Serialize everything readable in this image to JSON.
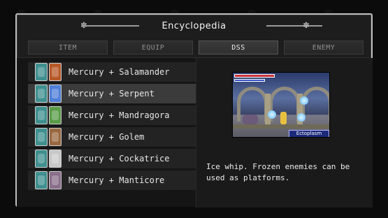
{
  "window": {
    "title": "Encyclopedia"
  },
  "tabs": [
    {
      "label": "ITEM",
      "active": false
    },
    {
      "label": "EQUIP",
      "active": false
    },
    {
      "label": "DSS",
      "active": true
    },
    {
      "label": "ENEMY",
      "active": false
    }
  ],
  "list": {
    "items": [
      {
        "label": "Mercury + Salamander",
        "card1": "#3f8f8f",
        "card2": "#b85a28",
        "selected": false
      },
      {
        "label": "Mercury + Serpent",
        "card1": "#3f8f8f",
        "card2": "#4f7fd8",
        "selected": true
      },
      {
        "label": "Mercury + Mandragora",
        "card1": "#3f8f8f",
        "card2": "#5a9c48",
        "selected": false
      },
      {
        "label": "Mercury + Golem",
        "card1": "#3f8f8f",
        "card2": "#9a6840",
        "selected": false
      },
      {
        "label": "Mercury + Cockatrice",
        "card1": "#3f8f8f",
        "card2": "#c8c8c8",
        "selected": false
      },
      {
        "label": "Mercury + Manticore",
        "card1": "#3f8f8f",
        "card2": "#8a6e8a",
        "selected": false
      }
    ],
    "scroll_position": 0.0
  },
  "detail": {
    "preview_enemy_label": "Ectoplasm",
    "description": "Ice whip. Frozen enemies can be used as platforms."
  },
  "colors": {
    "background": "#0b0b0b",
    "frame_border": "#bdbdbd",
    "selected_row": "#3b3b3b"
  }
}
